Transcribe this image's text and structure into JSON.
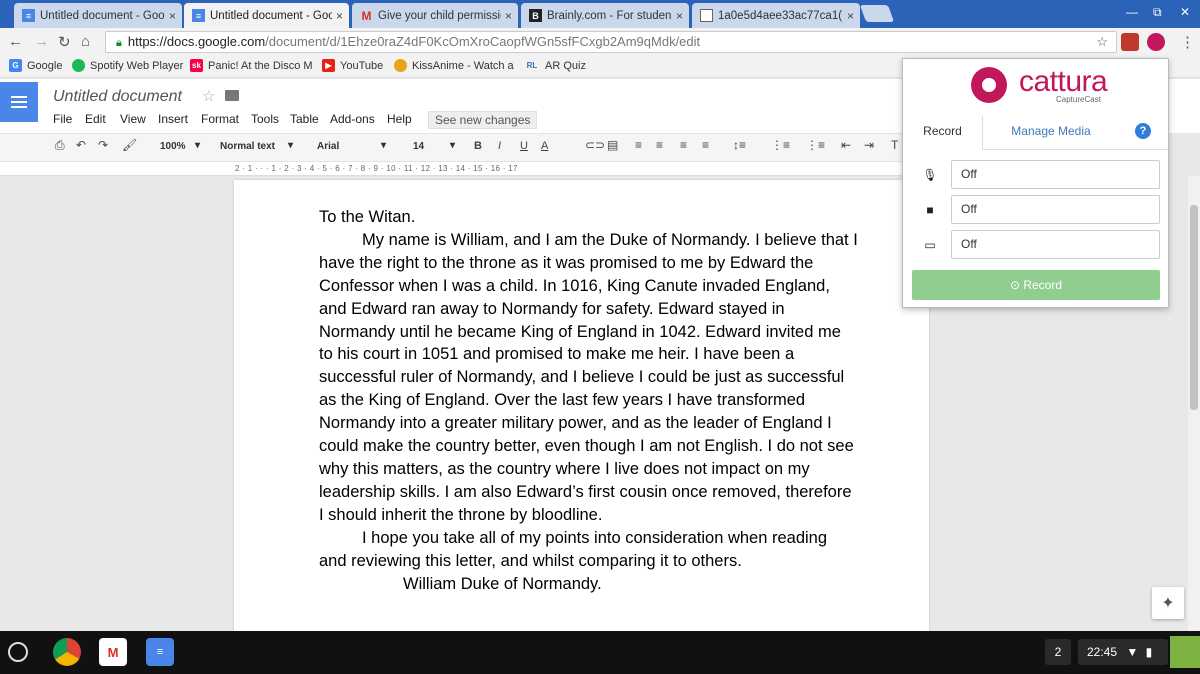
{
  "browser": {
    "tabs": [
      {
        "title": "Untitled document - Goo",
        "favicon": "docs-icon",
        "active": false
      },
      {
        "title": "Untitled document - Goo",
        "favicon": "docs-icon",
        "active": true
      },
      {
        "title": "Give your child permissio",
        "favicon": "gmail-icon",
        "active": false
      },
      {
        "title": "Brainly.com - For studen",
        "favicon": "brainly-icon",
        "active": false
      },
      {
        "title": "1a0e5d4aee33ac77ca1(",
        "favicon": "page-icon",
        "active": false
      }
    ],
    "close_glyph": "×",
    "url_host": "https://docs.google.com",
    "url_path": "/document/d/1Ehze0raZ4dF0KcOmXroCaopfWGn5sfFCxgb2Am9qMdk/edit",
    "bookmarks": [
      {
        "label": "Google",
        "icon": "google-icon",
        "color": "#4285f4"
      },
      {
        "label": "Spotify Web Player",
        "icon": "spotify-icon",
        "color": "#1db954"
      },
      {
        "label": "Panic! At the Disco M",
        "icon": "songkick-icon",
        "color": "#f80046"
      },
      {
        "label": "YouTube",
        "icon": "youtube-icon",
        "color": "#e62117"
      },
      {
        "label": "KissAnime - Watch a",
        "icon": "kissanime-icon",
        "color": "#e8a317"
      },
      {
        "label": "AR Quiz",
        "icon": "rl-icon",
        "color": "#3a6fb0"
      }
    ]
  },
  "docs": {
    "title": "Untitled document",
    "menu": [
      "File",
      "Edit",
      "View",
      "Insert",
      "Format",
      "Tools",
      "Table",
      "Add-ons",
      "Help"
    ],
    "see_changes": "See new changes",
    "toolbar": {
      "zoom": "100%",
      "style": "Normal text",
      "font": "Arial",
      "size": "14",
      "bold": "B",
      "italic": "I",
      "underline": "U",
      "text_color": "A"
    },
    "ruler_text": "2 · 1 · · · 1 · 2 · 3 · 4 · 5 · 6 · 7 · 8 · 9 · 10 · 11 · 12 · 13 · 14 · 15 · 16 · 17",
    "paragraphs": [
      {
        "text": "To the Witan.",
        "style": "plain"
      },
      {
        "text": "My name is William, and I am the Duke of Normandy. I believe that I have the right to the throne as it was promised to me by Edward the Confessor when I was a child. In 1016, King Canute invaded England, and Edward ran away to Normandy for safety. Edward stayed in Normandy until he became King of England in 1042. Edward invited me to his court in 1051 and promised to make me heir. I have been a successful ruler of Normandy, and I believe I could be just as successful as the King of England. Over the last few years I have transformed Normandy into a greater military power, and as the leader of England I could make the country better, even though I am not English. I do not see why this matters, as the country where I live does not impact on my leadership skills. I am also Edward’s first cousin once removed, therefore I should inherit the throne by bloodline.",
        "style": "indent"
      },
      {
        "text": "I hope you take all of my points into consideration when reading and reviewing this letter, and whilst comparing it to others.",
        "style": "indent"
      },
      {
        "text": "William Duke of Normandy.",
        "style": "signature"
      }
    ]
  },
  "cattura": {
    "brand": "cattura",
    "subtitle": "CaptureCast",
    "tab_record": "Record",
    "tab_media": "Manage Media",
    "help": "?",
    "rows": [
      {
        "icon": "microphone-icon",
        "value": "Off"
      },
      {
        "icon": "camera-icon",
        "value": "Off"
      },
      {
        "icon": "screen-icon",
        "value": "Off"
      }
    ],
    "record_button": "Record",
    "accent": "#c2185b"
  },
  "shelf": {
    "notification_count": "2",
    "time": "22:45"
  }
}
